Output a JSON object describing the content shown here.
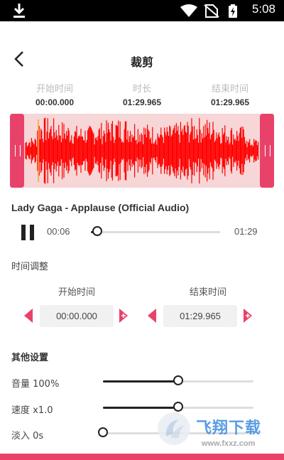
{
  "status_bar": {
    "time": "5:08",
    "icons": [
      "download-icon",
      "wifi-icon",
      "no-sim-icon",
      "battery-charging-icon"
    ]
  },
  "header": {
    "title": "裁剪",
    "back_icon": "chevron-left-icon"
  },
  "time_info": {
    "start": {
      "label": "开始时间",
      "value": "00:00.000"
    },
    "duration": {
      "label": "时长",
      "value": "01:29.965"
    },
    "end": {
      "label": "结束时间",
      "value": "01:29.965"
    }
  },
  "waveform": {
    "color": "#ff0000",
    "handle_color": "#e8426a",
    "background": "#f6d6d6"
  },
  "player": {
    "song": "Lady Gaga - Applause (Official Audio)",
    "current": "00:06",
    "total": "01:29",
    "progress": 0.05
  },
  "time_adjust": {
    "heading": "时间调整",
    "start_label": "开始时间",
    "start_value": "00:00.000",
    "end_label": "结束时间",
    "end_value": "01:29.965"
  },
  "other_settings": {
    "heading": "其他设置",
    "volume": {
      "label": "音量 100%",
      "level": 0.5
    },
    "speed": {
      "label": "速度 x1.0",
      "level": 0.5
    },
    "fade_in": {
      "label": "淡入 0s",
      "level": 0.0
    }
  },
  "watermark": {
    "text": "飞翔下载",
    "url": "www.fxxz.com"
  },
  "accent": "#e8426a"
}
